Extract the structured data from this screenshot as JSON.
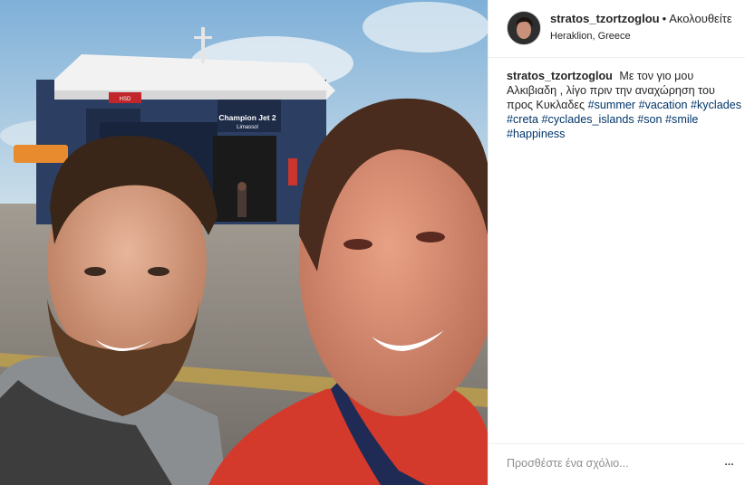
{
  "post": {
    "username": "stratos_tzortzoglou",
    "separator": "•",
    "follow_status": "Ακολουθείτε",
    "location": "Heraklion, Greece",
    "photo": {
      "ship_name": "Champion Jet 2",
      "ship_port": "Limassol",
      "ship_sign": "HSD"
    },
    "caption": {
      "username": "stratos_tzortzoglou",
      "text": "Με τον γιο μου Αλκιβιαδη , λίγο πριν την αναχώρηση του προς Κυκλαδες",
      "hashtags": [
        "#summer",
        "#vacation",
        "#kyclades",
        "#creta",
        "#cyclades_islands",
        "#son",
        "#smile",
        "#happiness"
      ]
    },
    "comment_placeholder": "Προσθέστε ένα σχόλιο...",
    "more_icon": "..."
  }
}
